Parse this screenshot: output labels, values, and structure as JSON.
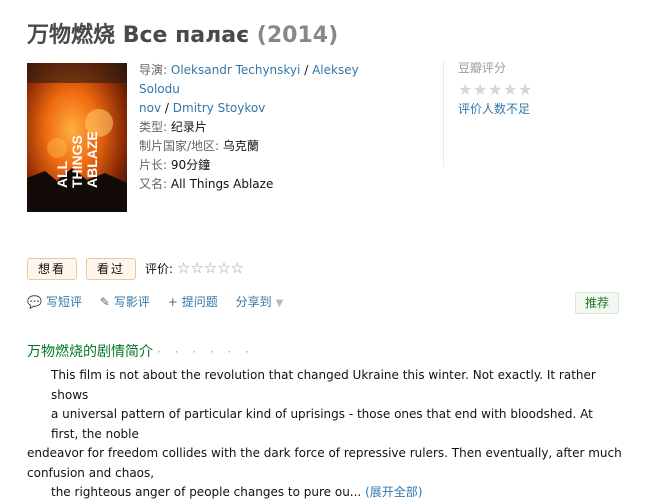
{
  "title": {
    "cn": "万物燃烧",
    "original": "Все палає",
    "year": "(2014)"
  },
  "poster": {
    "lines": [
      "ALL",
      "THINGS",
      "ABLAZE"
    ]
  },
  "info": {
    "director_label": "导演:",
    "directors": [
      "Oleksandr Techynskyi",
      "Aleksey Solodu",
      "nov",
      "Dmitry Stoykov"
    ],
    "sep": "/",
    "genre_label": "类型:",
    "genre": "纪录片",
    "country_label": "制片国家/地区:",
    "country": "乌克蘭",
    "runtime_label": "片长:",
    "runtime": "90分鐘",
    "aka_label": "又名:",
    "aka": "All Things Ablaze"
  },
  "rating": {
    "label": "豆瓣评分",
    "stars": [
      "★",
      "★",
      "★",
      "★",
      "★"
    ],
    "few_label": "评价人数不足"
  },
  "actions": {
    "want": "想看",
    "seen": "看过",
    "rate_label": "评价:",
    "rate_stars": "☆☆☆☆☆"
  },
  "ops": {
    "short_review": "写短评",
    "review": "写影评",
    "question": "提问题",
    "share": "分享到",
    "recommend": "推荐",
    "icon_comment": "💬",
    "icon_pencil": "✎",
    "icon_plus": "+",
    "icon_caret": "▼"
  },
  "summary": {
    "heading": "万物燃烧的剧情简介",
    "dots": "· · · · · ·",
    "line1": "This film is not about the revolution that changed Ukraine this winter. Not exactly. It rather shows",
    "line2": "a universal pattern of particular kind of uprisings - those ones that end with bloodshed. At first, the noble",
    "line3": "endeavor for freedom collides with the dark force of repressive rulers. Then eventually, after much confusion and chaos,",
    "line4": "the righteous anger of people changes to pure ou...",
    "expand": "(展开全部)"
  }
}
